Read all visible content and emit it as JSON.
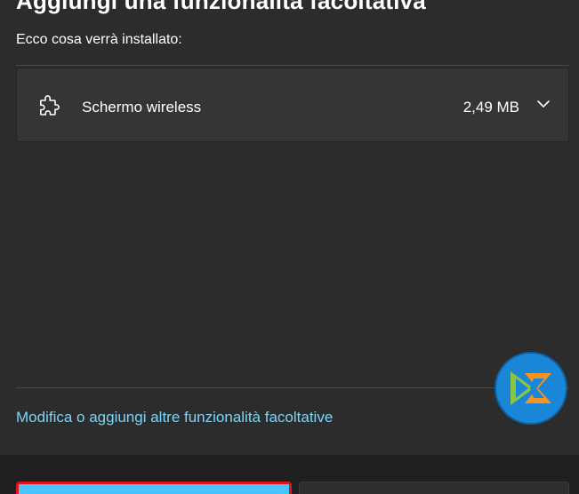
{
  "dialog": {
    "title": "Aggiungi una funzionalità facoltativa",
    "subtitle": "Ecco cosa verrà installato:"
  },
  "feature": {
    "name": "Schermo wireless",
    "size": "2,49 MB",
    "icon": "puzzle-icon",
    "expand_icon": "chevron-down-icon"
  },
  "link": {
    "label": "Modifica o aggiungi altre funzionalità facoltative",
    "color": "#7fd3f4"
  },
  "footer": {
    "primary_button_label": "",
    "secondary_button_label": "",
    "primary_color": "#4cc2ff",
    "highlight_color": "#e3121b"
  }
}
